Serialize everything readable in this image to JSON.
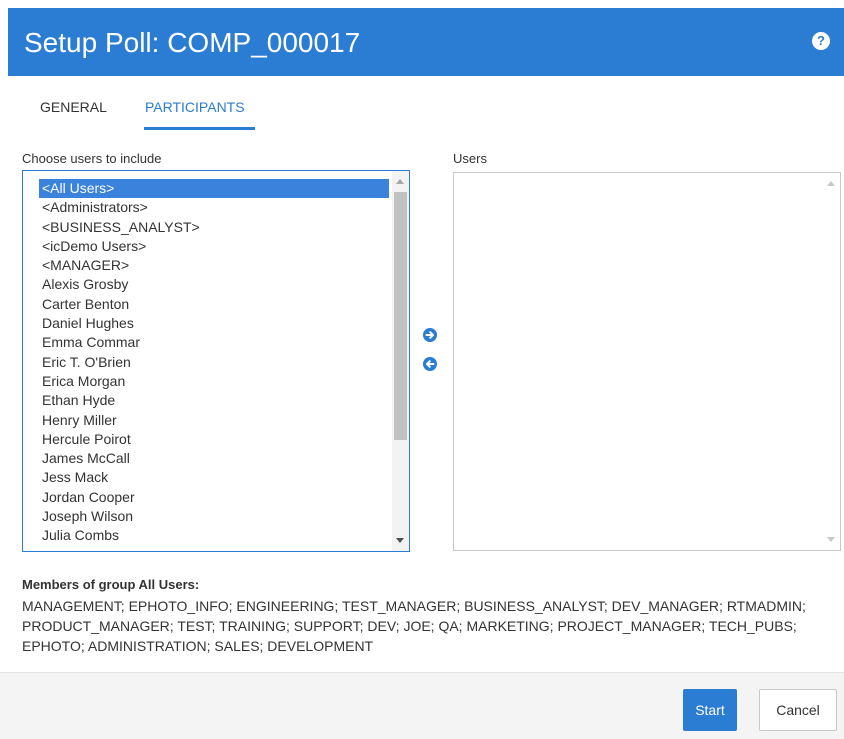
{
  "dialog": {
    "title": "Setup Poll: COMP_000017",
    "help_icon": "help-circle-icon"
  },
  "tabs": [
    {
      "label": "GENERAL",
      "active": false
    },
    {
      "label": "PARTICIPANTS",
      "active": true
    }
  ],
  "left_list": {
    "label": "Choose users to include",
    "selected_index": 0,
    "items": [
      "<All Users>",
      "<Administrators>",
      "<BUSINESS_ANALYST>",
      "<icDemo Users>",
      "<MANAGER>",
      "Alexis Grosby",
      "Carter Benton",
      "Daniel Hughes",
      "Emma Commar",
      "Eric T. O'Brien",
      "Erica Morgan",
      "Ethan Hyde",
      "Henry Miller",
      "Hercule Poirot",
      "James McCall",
      "Jess Mack",
      "Jordan Cooper",
      "Joseph Wilson",
      "Julia Combs"
    ]
  },
  "right_list": {
    "label": "Users",
    "items": []
  },
  "move_buttons": {
    "add_icon": "arrow-right-circle-icon",
    "remove_icon": "arrow-left-circle-icon"
  },
  "members": {
    "title": "Members of group All Users:",
    "text": "MANAGEMENT; EPHOTO_INFO; ENGINEERING; TEST_MANAGER; BUSINESS_ANALYST; DEV_MANAGER; RTMADMIN; PRODUCT_MANAGER; TEST; TRAINING; SUPPORT; DEV; JOE; QA; MARKETING; PROJECT_MANAGER; TECH_PUBS; EPHOTO; ADMINISTRATION; SALES; DEVELOPMENT"
  },
  "footer": {
    "start_label": "Start",
    "cancel_label": "Cancel"
  },
  "colors": {
    "accent": "#2b7cd3",
    "selection": "#3b82dc"
  }
}
